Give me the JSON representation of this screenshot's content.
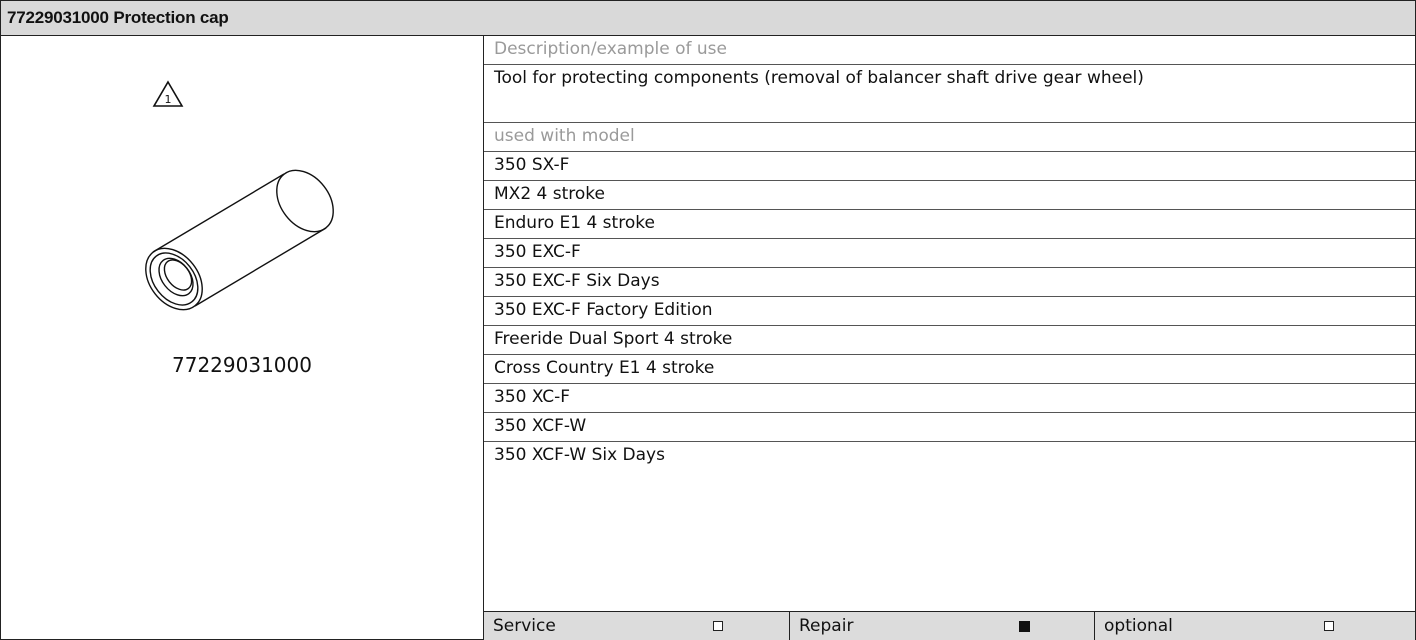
{
  "header": {
    "title": "77229031000 Protection cap"
  },
  "figure": {
    "warning_number": "1",
    "part_number": "77229031000"
  },
  "description": {
    "label": "Description/example of use",
    "text": "Tool for protecting components (removal of balancer shaft drive gear wheel)"
  },
  "models": {
    "label": "used with model",
    "items": [
      "350 SX-F",
      "MX2 4 stroke",
      "Enduro E1 4 stroke",
      "350 EXC-F",
      "350 EXC-F Six Days",
      "350 EXC-F Factory Edition",
      "Freeride Dual Sport 4 stroke",
      "Cross Country E1 4 stroke",
      "350 XC-F",
      "350 XCF-W",
      "350 XCF-W Six Days"
    ]
  },
  "footer": {
    "service": {
      "label": "Service",
      "checked": false
    },
    "repair": {
      "label": "Repair",
      "checked": true
    },
    "optional": {
      "label": "optional",
      "checked": false
    }
  }
}
